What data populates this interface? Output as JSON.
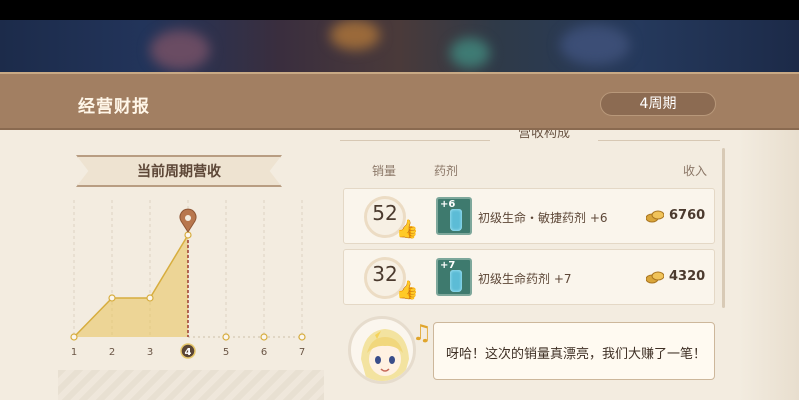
{
  "header": {
    "title": "经营财报",
    "period": "4周期"
  },
  "chart_section": {
    "title": "当前周期营收"
  },
  "chart_data": {
    "type": "area",
    "title": "当前周期营收",
    "categories": [
      "1",
      "2",
      "3",
      "4",
      "5",
      "6",
      "7"
    ],
    "highlighted_category": "4",
    "series": [
      {
        "values": [
          0,
          1.3,
          1.3,
          3.4
        ]
      }
    ],
    "ylim": [
      0,
      4
    ],
    "grid": true,
    "accent": "#e8c25a"
  },
  "revenue_section": {
    "title": "营收构成"
  },
  "columns": {
    "qty": "销量",
    "potion": "药剂",
    "income": "收入"
  },
  "rows": [
    {
      "qty": "52",
      "level": "+6",
      "name": "初级生命・敏捷药剂 +6",
      "income": "6760"
    },
    {
      "qty": "32",
      "level": "+7",
      "name": "初级生命药剂 +7",
      "income": "4320"
    }
  ],
  "dialog": {
    "text": "呀哈！这次的销量真漂亮，我们大赚了一笔！"
  },
  "icons": {
    "thumb": "thumbs-up-icon",
    "coin": "gold-coin-icon",
    "note": "music-note-icon",
    "pin": "map-pin-icon"
  }
}
